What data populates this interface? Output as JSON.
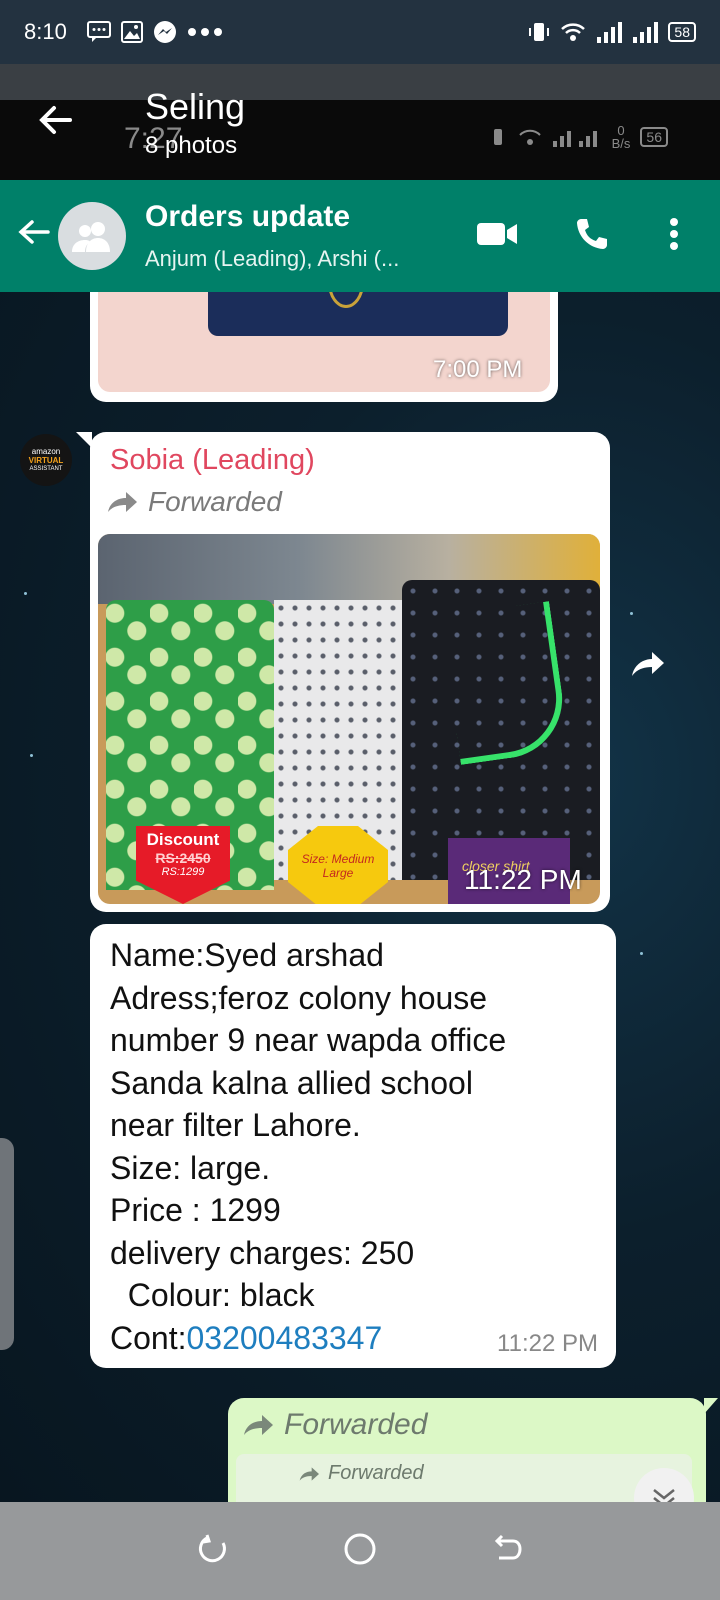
{
  "status_bar": {
    "time": "8:10",
    "battery": "58"
  },
  "viewer": {
    "title": "Seling",
    "subtitle": "8 photos",
    "ghost_time": "7:27",
    "ghost_speed": "0",
    "ghost_speed_unit": "B/s",
    "ghost_battery": "56"
  },
  "chat_header": {
    "title": "Orders update",
    "subtitle": "Anjum (Leading), Arshi (..."
  },
  "messages": [
    {
      "time": "7:00 PM"
    },
    {
      "avatar_lines": [
        "amazon",
        "VIRTUAL",
        "ASSISTANT"
      ],
      "sender": "Sobia (Leading)",
      "forwarded": "Forwarded",
      "badge_discount": "Discount",
      "badge_old_price": "RS:2450",
      "badge_new_price": "RS:1299",
      "badge_size": "Size: Medium Large",
      "badge_closer": "closer shirt",
      "time": "11:22 PM"
    },
    {
      "lines": [
        "Name:Syed arshad",
        "Adress;feroz colony house",
        "number 9 near wapda office",
        "Sanda kalna allied school",
        "near filter Lahore.",
        "Size: large.",
        "Price : 1299",
        "delivery charges: 250",
        "  Colour: black"
      ],
      "contact_prefix": "Cont:",
      "contact_number": "03200483347",
      "time": "11:22 PM"
    },
    {
      "forwarded": "Forwarded",
      "inner_forwarded": "Forwarded"
    }
  ],
  "colors": {
    "header_green": "#008069",
    "sender_pink": "#e0475f",
    "link_blue": "#1e7ebf",
    "outgoing_bubble": "#dcf8c6"
  }
}
